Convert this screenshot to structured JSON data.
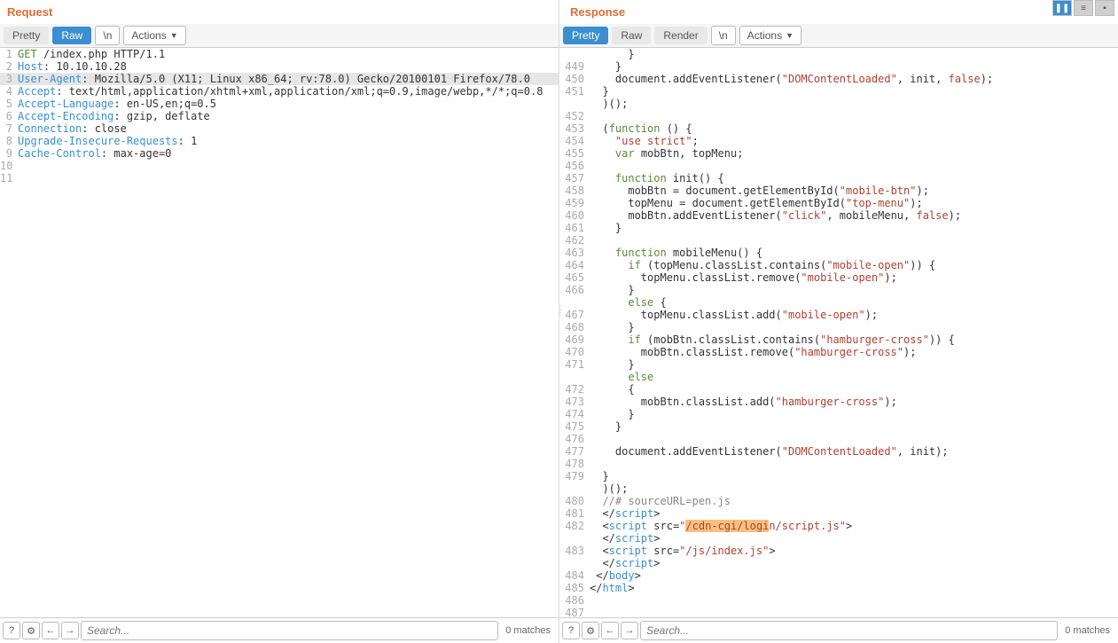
{
  "request": {
    "title": "Request",
    "tabs": {
      "pretty": "Pretty",
      "raw": "Raw",
      "escape": "\\n",
      "actions": "Actions"
    },
    "lines": [
      {
        "n": 1,
        "html": "<span class='tk-method'>GET</span> /index.php HTTP/1.1"
      },
      {
        "n": 2,
        "html": "<span class='tk-header'>Host</span>: 10.10.10.28"
      },
      {
        "n": 3,
        "html": "<span class='tk-header'>User-Agent</span>: Mozilla/5.0 (X11; Linux x86_64; rv:78.0) Gecko/20100101 Firefox/78.0",
        "selected": true
      },
      {
        "n": 4,
        "html": "<span class='tk-header'>Accept</span>: text/html,application/xhtml+xml,application/xml;q=0.9,image/webp,*/*;q=0.8"
      },
      {
        "n": 5,
        "html": "<span class='tk-header'>Accept-Language</span>: en-US,en;q=0.5"
      },
      {
        "n": 6,
        "html": "<span class='tk-header'>Accept-Encoding</span>: gzip, deflate"
      },
      {
        "n": 7,
        "html": "<span class='tk-header'>Connection</span>: close"
      },
      {
        "n": 8,
        "html": "<span class='tk-header'>Upgrade-Insecure-Requests</span>: 1"
      },
      {
        "n": 9,
        "html": "<span class='tk-header'>Cache-Control</span>: max-age=0"
      },
      {
        "n": 10,
        "html": ""
      },
      {
        "n": 11,
        "html": ""
      }
    ]
  },
  "response": {
    "title": "Response",
    "tabs": {
      "pretty": "Pretty",
      "raw": "Raw",
      "render": "Render",
      "escape": "\\n",
      "actions": "Actions"
    },
    "lines": [
      {
        "n": "",
        "html": "      }"
      },
      {
        "n": 449,
        "html": "    }"
      },
      {
        "n": 450,
        "html": "    document.addEventListener(<span class='tk-str'>\"DOMContentLoaded\"</span>, init, <span class='tk-bool'>false</span>);"
      },
      {
        "n": 451,
        "html": "  }"
      },
      {
        "n": "",
        "html": "  )();"
      },
      {
        "n": 452,
        "html": ""
      },
      {
        "n": 453,
        "html": "  (<span class='tk-func'>function</span> () {"
      },
      {
        "n": 454,
        "html": "    <span class='tk-str'>\"use strict\"</span>;"
      },
      {
        "n": 455,
        "html": "    <span class='tk-func'>var</span> mobBtn, topMenu;"
      },
      {
        "n": 456,
        "html": ""
      },
      {
        "n": 457,
        "html": "    <span class='tk-func'>function</span> init() {"
      },
      {
        "n": 458,
        "html": "      mobBtn = document.getElementById(<span class='tk-str'>\"mobile-btn\"</span>);"
      },
      {
        "n": 459,
        "html": "      topMenu = document.getElementById(<span class='tk-str'>\"top-menu\"</span>);"
      },
      {
        "n": 460,
        "html": "      mobBtn.addEventListener(<span class='tk-str'>\"click\"</span>, mobileMenu, <span class='tk-bool'>false</span>);"
      },
      {
        "n": 461,
        "html": "    }"
      },
      {
        "n": 462,
        "html": ""
      },
      {
        "n": 463,
        "html": "    <span class='tk-func'>function</span> mobileMenu() {"
      },
      {
        "n": 464,
        "html": "      <span class='tk-func'>if</span> (topMenu.classList.contains(<span class='tk-str'>\"mobile-open\"</span>)) {"
      },
      {
        "n": 465,
        "html": "        topMenu.classList.remove(<span class='tk-str'>\"mobile-open\"</span>);"
      },
      {
        "n": 466,
        "html": "      }"
      },
      {
        "n": "",
        "html": "      <span class='tk-func'>else</span> {"
      },
      {
        "n": 467,
        "html": "        topMenu.classList.add(<span class='tk-str'>\"mobile-open\"</span>);"
      },
      {
        "n": 468,
        "html": "      }"
      },
      {
        "n": 469,
        "html": "      <span class='tk-func'>if</span> (mobBtn.classList.contains(<span class='tk-str'>\"hamburger-cross\"</span>)) {"
      },
      {
        "n": 470,
        "html": "        mobBtn.classList.remove(<span class='tk-str'>\"hamburger-cross\"</span>);"
      },
      {
        "n": 471,
        "html": "      }"
      },
      {
        "n": "",
        "html": "      <span class='tk-func'>else</span>"
      },
      {
        "n": 472,
        "html": "      {"
      },
      {
        "n": 473,
        "html": "        mobBtn.classList.add(<span class='tk-str'>\"hamburger-cross\"</span>);"
      },
      {
        "n": 474,
        "html": "      }"
      },
      {
        "n": 475,
        "html": "    }"
      },
      {
        "n": 476,
        "html": ""
      },
      {
        "n": 477,
        "html": "    document.addEventListener(<span class='tk-str'>\"DOMContentLoaded\"</span>, init);"
      },
      {
        "n": 478,
        "html": ""
      },
      {
        "n": 479,
        "html": "  }"
      },
      {
        "n": "",
        "html": "  )();"
      },
      {
        "n": 480,
        "html": "  <span class='tk-comment'>//# sourceURL=pen.js</span>"
      },
      {
        "n": 481,
        "html": "  &lt;/<span class='tk-tag'>script</span>&gt;"
      },
      {
        "n": 482,
        "html": "  &lt;<span class='tk-tag'>script</span> src=<span class='tk-str'>\"<span class='hl'>/cdn-cgi/logi</span>n/script.js\"</span>&gt;"
      },
      {
        "n": "",
        "html": "  &lt;/<span class='tk-tag'>script</span>&gt;"
      },
      {
        "n": 483,
        "html": "  &lt;<span class='tk-tag'>script</span> src=<span class='tk-str'>\"/js/index.js\"</span>&gt;"
      },
      {
        "n": "",
        "html": "  &lt;/<span class='tk-tag'>script</span>&gt;"
      },
      {
        "n": 484,
        "html": " &lt;/<span class='tk-tag'>body</span>&gt;"
      },
      {
        "n": 485,
        "html": "&lt;/<span class='tk-tag'>html</span>&gt;"
      },
      {
        "n": 486,
        "html": ""
      },
      {
        "n": 487,
        "html": ""
      }
    ]
  },
  "footer": {
    "search_placeholder": "Search...",
    "matches": "0 matches"
  }
}
